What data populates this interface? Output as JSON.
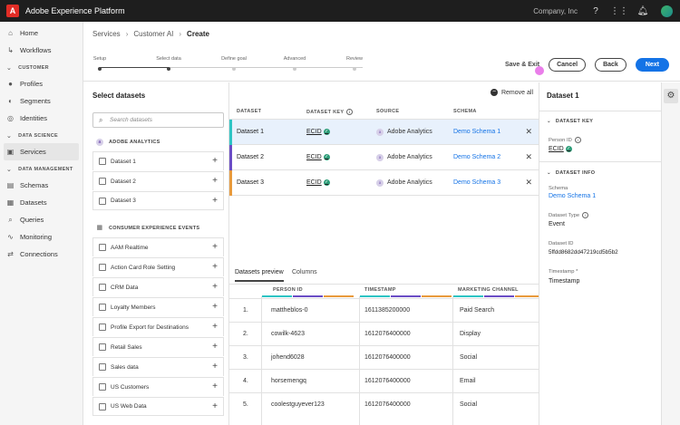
{
  "topbar": {
    "app_title": "Adobe Experience Platform",
    "org": "Company, Inc",
    "icons": [
      "help-icon",
      "bell-icon",
      "apps-grid-icon",
      "notifications-icon",
      "avatar"
    ]
  },
  "nav": {
    "items_top": [
      {
        "label": "Home",
        "icon": "home-icon"
      },
      {
        "label": "Workflows",
        "icon": "workflows-icon"
      }
    ],
    "section_customer": "CUSTOMER",
    "items_customer": [
      {
        "label": "Profiles",
        "icon": "profile-icon"
      },
      {
        "label": "Segments",
        "icon": "segments-icon"
      },
      {
        "label": "Identities",
        "icon": "identity-icon"
      }
    ],
    "section_data_science": "DATA SCIENCE",
    "items_data_science": [
      {
        "label": "Services",
        "icon": "services-icon"
      }
    ],
    "section_data_management": "DATA MANAGEMENT",
    "items_data_management": [
      {
        "label": "Schemas",
        "icon": "schemas-icon"
      },
      {
        "label": "Datasets",
        "icon": "datasets-icon"
      },
      {
        "label": "Queries",
        "icon": "queries-icon"
      },
      {
        "label": "Monitoring",
        "icon": "monitoring-icon"
      },
      {
        "label": "Connections",
        "icon": "connections-icon"
      }
    ]
  },
  "header": {
    "breadcrumb": [
      "Services",
      "Customer AI",
      "Create"
    ],
    "steps": [
      "Setup",
      "Select data",
      "Define goal",
      "Advanced",
      "Review"
    ],
    "save_exit": "Save & Exit",
    "cancel": "Cancel",
    "back": "Back",
    "next": "Next"
  },
  "left": {
    "title": "Select datasets",
    "search_placeholder": "Search datasets",
    "group1": "ADOBE ANALYTICS",
    "group1_items": [
      "Dataset 1",
      "Dataset 2",
      "Dataset 3"
    ],
    "group2": "CONSUMER EXPERIENCE EVENTS",
    "group2_items": [
      "AAM Realtime",
      "Action Card Role Setting",
      "CRM Data",
      "Loyalty Members",
      "Profile Export for Destinations",
      "Retail Sales",
      "Sales data",
      "US Customers",
      "US Web Data"
    ]
  },
  "center": {
    "remove_all": "Remove all",
    "headers": [
      "DATASET",
      "DATASET KEY",
      "SOURCE",
      "SCHEMA"
    ],
    "rows": [
      {
        "dataset": "Dataset 1",
        "key": "ECID",
        "source": "Adobe Analytics",
        "schema": "Demo Schema 1",
        "color": "#2ec4c4"
      },
      {
        "dataset": "Dataset 2",
        "key": "ECID",
        "source": "Adobe Analytics",
        "schema": "Demo Schema 2",
        "color": "#6b4dc5"
      },
      {
        "dataset": "Dataset 3",
        "key": "ECID",
        "source": "Adobe Analytics",
        "schema": "Demo Schema 3",
        "color": "#e89a3c"
      }
    ],
    "tabs": [
      "Datasets preview",
      "Columns"
    ],
    "preview_headers": [
      "PERSON ID",
      "TIMESTAMP",
      "MARKETING CHANNEL"
    ],
    "preview_rows": [
      {
        "n": "1.",
        "person": "mattheblos-0",
        "ts": "1611385200000",
        "channel": "Paid Search"
      },
      {
        "n": "2.",
        "person": "cowilk-4623",
        "ts": "1612076400000",
        "channel": "Display"
      },
      {
        "n": "3.",
        "person": "johend6028",
        "ts": "1612076400000",
        "channel": "Social"
      },
      {
        "n": "4.",
        "person": "horsemengq",
        "ts": "1612076400000",
        "channel": "Email"
      },
      {
        "n": "5.",
        "person": "coolestguyever123",
        "ts": "1612076400000",
        "channel": "Social"
      }
    ]
  },
  "right": {
    "title": "Dataset 1",
    "sec_key": "DATASET KEY",
    "person_id_label": "Person ID",
    "person_id_value": "ECID",
    "sec_info": "DATASET INFO",
    "schema_label": "Schema",
    "schema_value": "Demo Schema 1",
    "type_label": "Dataset Type",
    "type_value": "Event",
    "id_label": "Dataset ID",
    "id_value": "5ffdd8682dd47219cd5b5b2",
    "ts_label": "Timestamp *",
    "ts_value": "Timestamp"
  }
}
